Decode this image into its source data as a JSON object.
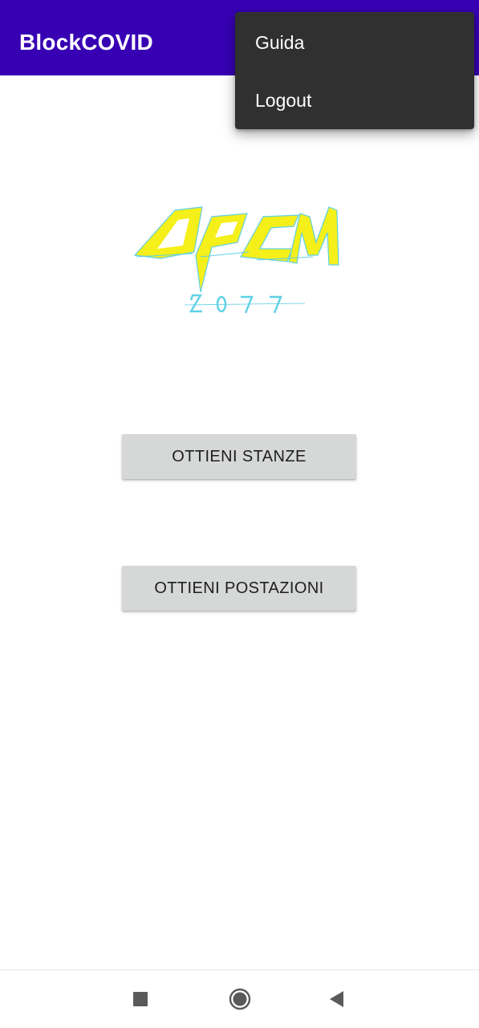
{
  "app_bar": {
    "title": "BlockCOVID",
    "color": "#3700b3"
  },
  "overflow_menu": {
    "items": [
      {
        "label": "Guida"
      },
      {
        "label": "Logout"
      }
    ]
  },
  "logo": {
    "text": "DPCM",
    "subtext": "2077",
    "colors": {
      "primary": "#f5ef1a",
      "accent": "#5fd0e6"
    }
  },
  "buttons": {
    "get_rooms": "OTTIENI STANZE",
    "get_workstations": "OTTIENI POSTAZIONI"
  },
  "nav_bar": {
    "icons": [
      "recents-icon",
      "home-icon",
      "back-icon"
    ]
  }
}
